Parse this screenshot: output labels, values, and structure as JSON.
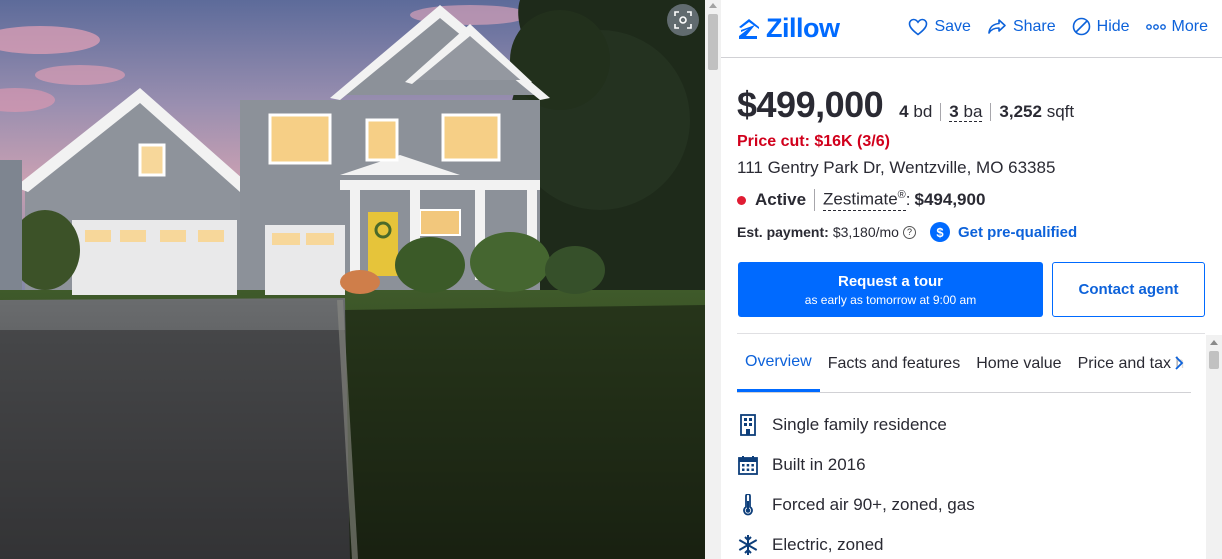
{
  "header": {
    "logo_text": "Zillow",
    "actions": [
      {
        "label": "Save",
        "icon": "heart-icon"
      },
      {
        "label": "Share",
        "icon": "share-icon"
      },
      {
        "label": "Hide",
        "icon": "hide-icon"
      },
      {
        "label": "More",
        "icon": "more-icon"
      }
    ]
  },
  "listing": {
    "price": "$499,000",
    "beds_value": "4",
    "beds_unit": "bd",
    "baths_value": "3",
    "baths_unit": "ba",
    "sqft_value": "3,252",
    "sqft_unit": "sqft",
    "price_cut": "Price cut: $16K (3/6)",
    "address": "111 Gentry Park Dr, Wentzville, MO 63385",
    "status": "Active",
    "zestimate_label": "Zestimate",
    "zestimate_reg": "®",
    "zestimate_value": "$494,900",
    "payment_label": "Est. payment:",
    "payment_value": "$3,180/mo",
    "help_glyph": "?",
    "dollar_glyph": "$",
    "prequalified": "Get pre-qualified"
  },
  "cta": {
    "tour_title": "Request a tour",
    "tour_sub": "as early as tomorrow at 9:00 am",
    "contact": "Contact agent"
  },
  "tabs": [
    {
      "label": "Overview",
      "active": true
    },
    {
      "label": "Facts and features",
      "active": false
    },
    {
      "label": "Home value",
      "active": false
    },
    {
      "label": "Price and tax h",
      "active": false
    }
  ],
  "features": [
    {
      "icon": "building-icon",
      "text": "Single family residence"
    },
    {
      "icon": "calendar-icon",
      "text": "Built in 2016"
    },
    {
      "icon": "thermometer-icon",
      "text": "Forced air 90+, zoned, gas"
    },
    {
      "icon": "snowflake-icon",
      "text": "Electric, zoned"
    }
  ],
  "colors": {
    "brand": "#006aff",
    "link": "#0d62da",
    "alert": "#d1001c",
    "status_dot": "#e01c33"
  }
}
